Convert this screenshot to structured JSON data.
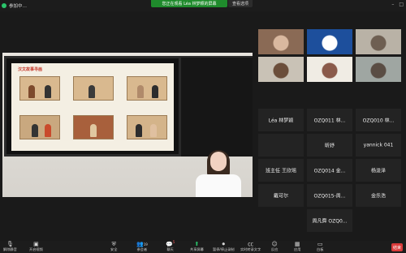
{
  "topbar": {
    "meeting_label": "参加中…",
    "share_banner": "您正在观看 Léa 林梦颖的屏幕",
    "view_options": "查看选项"
  },
  "stage": {
    "slide_title": "汉文故事寻画"
  },
  "participants": [
    {
      "label": "",
      "has_video": true
    },
    {
      "label": "",
      "has_video": true
    },
    {
      "label": "",
      "has_video": true
    },
    {
      "label": "",
      "has_video": true
    },
    {
      "label": "",
      "has_video": true
    },
    {
      "label": "",
      "has_video": true
    },
    {
      "label": "Léa 林梦颖",
      "has_video": false
    },
    {
      "label": "OZQ011 林...",
      "has_video": false
    },
    {
      "label": "OZQ010 林...",
      "has_video": false
    },
    {
      "label": "",
      "has_video": false
    },
    {
      "label": "昕妤",
      "has_video": false
    },
    {
      "label": "yannick 041",
      "has_video": false
    },
    {
      "label": "班主任 王欣瑶",
      "has_video": false
    },
    {
      "label": "OZQ014 金...",
      "has_video": false
    },
    {
      "label": "杨浚泽",
      "has_video": false
    },
    {
      "label": "戴可尔",
      "has_video": false
    },
    {
      "label": "OZQ015-周...",
      "has_video": false
    },
    {
      "label": "金乐浩",
      "has_video": false
    },
    {
      "label": "周凡舜 OZQ0...",
      "has_video": false
    }
  ],
  "toolbar": {
    "mute": "解除静音",
    "video": "开启视频",
    "security": "安全",
    "participants": "参会者",
    "participants_count": "19",
    "chat": "聊天",
    "chat_badge": "5",
    "share": "共享屏幕",
    "pause_share": "暂停/停止录制",
    "live_transcript": "实时转录文字",
    "reactions": "反应",
    "apps": "应用",
    "whiteboard": "白板",
    "end": "结束"
  },
  "colors": {
    "share_green": "#1f8b2c",
    "end_red": "#d93a3a",
    "background": "#1a1a1a"
  }
}
